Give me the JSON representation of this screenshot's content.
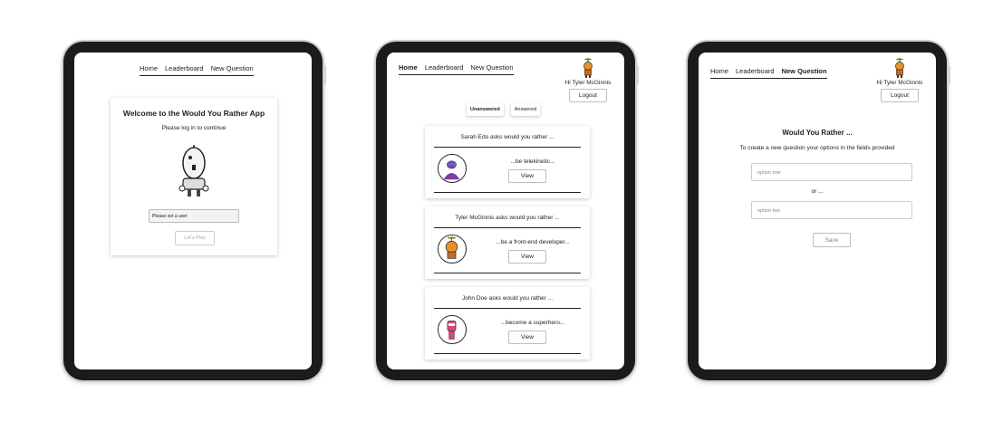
{
  "login": {
    "nav": [
      "Home",
      "Leaderboard",
      "New Question"
    ],
    "title": "Welcome to the Would You Rather App",
    "subtitle": "Please log in to continue",
    "select_value": "Please set a user",
    "play_label": "Let's Play"
  },
  "home": {
    "nav": [
      "Home",
      "Leaderboard",
      "New Question"
    ],
    "user_greeting": "Hi Tyler McGinnis",
    "logout_label": "Logout",
    "tabs": [
      "Unanswered",
      "Answered"
    ],
    "questions": [
      {
        "asks": "Sarah Edo asks would you rather ...",
        "text": "...be telekinetic...",
        "view": "View"
      },
      {
        "asks": "Tyler McGinnis asks would you rather ...",
        "text": "...be a front-end developer...",
        "view": "View"
      },
      {
        "asks": "John Doe asks would you rather ...",
        "text": "...become a superhero...",
        "view": "View"
      }
    ]
  },
  "newq": {
    "nav": [
      "Home",
      "Leaderboard",
      "New Question"
    ],
    "user_greeting": "Hi Tyler McGinnis",
    "logout_label": "Logout",
    "title": "Would You Rather ...",
    "subtitle": "To create a new question your options in the fields provided",
    "option_one_placeholder": "option one",
    "or_label": "or ...",
    "option_two_placeholder": "option two",
    "save_label": "Save"
  },
  "colors": {
    "frame": "#1b1b1b",
    "avatar_orange": "#e8922e",
    "avatar_purple": "#7b3f9e",
    "avatar_pink": "#e0457a"
  }
}
